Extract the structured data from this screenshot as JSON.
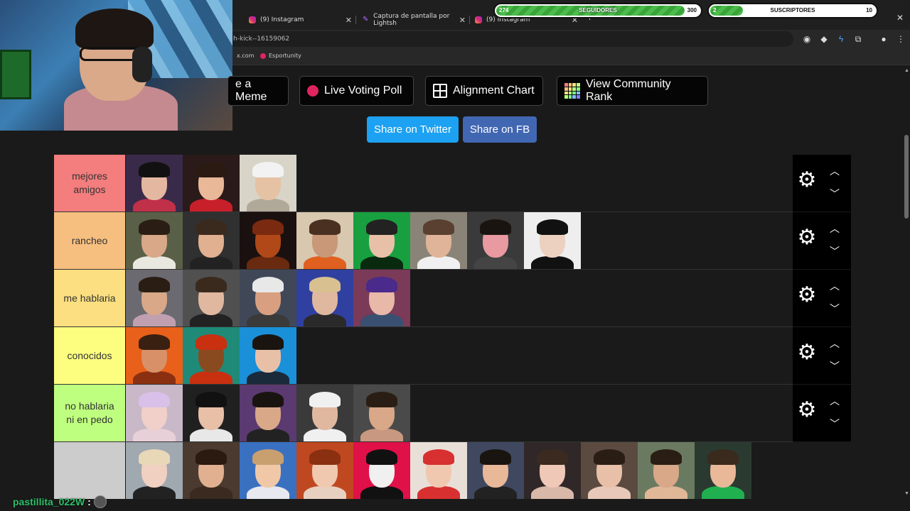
{
  "browser": {
    "tabs": [
      {
        "title": "(9) Instagram",
        "icon": "instagram-icon"
      },
      {
        "title": "Captura de pantalla por Lightsh",
        "icon": "lightshot-pen-icon"
      },
      {
        "title": "(9) Instagram",
        "icon": "instagram-icon"
      }
    ],
    "url": "h-kick--16159062",
    "bookmarks": [
      {
        "label": "x.com"
      },
      {
        "label": "Esportunity"
      }
    ]
  },
  "overlay": {
    "seguidores": {
      "label": "SEGUIDORES",
      "current": "274",
      "goal": "300",
      "progress": 0.91
    },
    "suscriptores": {
      "label": "SUSCRIPTORES",
      "current": "2",
      "goal": "10",
      "progress": 0.2
    }
  },
  "actions": {
    "meme_label": "e a Meme",
    "poll_label": "Live Voting Poll",
    "alignment_label": "Alignment Chart",
    "rank_label": "View Community Rank",
    "share_twitter_label": "Share on Twitter",
    "share_fb_label": "Share on FB"
  },
  "colors": {
    "twitter": "#1da1f2",
    "facebook": "#4267b2",
    "tier_s": "#f47d7d",
    "tier_a": "#f7bf7f",
    "tier_b": "#fbdf80",
    "tier_c": "#fdfe7f",
    "tier_d": "#bfff7f",
    "tier_unranked": "#cccccc"
  },
  "tiers": [
    {
      "label_line1": "mejores",
      "label_line2": "amigos",
      "count": 3
    },
    {
      "label_line1": "rancheo",
      "label_line2": "",
      "count": 8
    },
    {
      "label_line1": "me hablaria",
      "label_line2": "",
      "count": 5
    },
    {
      "label_line1": "conocidos",
      "label_line2": "",
      "count": 3
    },
    {
      "label_line1": "no hablaria",
      "label_line2": "ni en pedo",
      "count": 5
    },
    {
      "label_line1": "",
      "label_line2": "",
      "count": 11
    }
  ],
  "chat": {
    "username": "pastillita_022W",
    "separator": ":"
  }
}
